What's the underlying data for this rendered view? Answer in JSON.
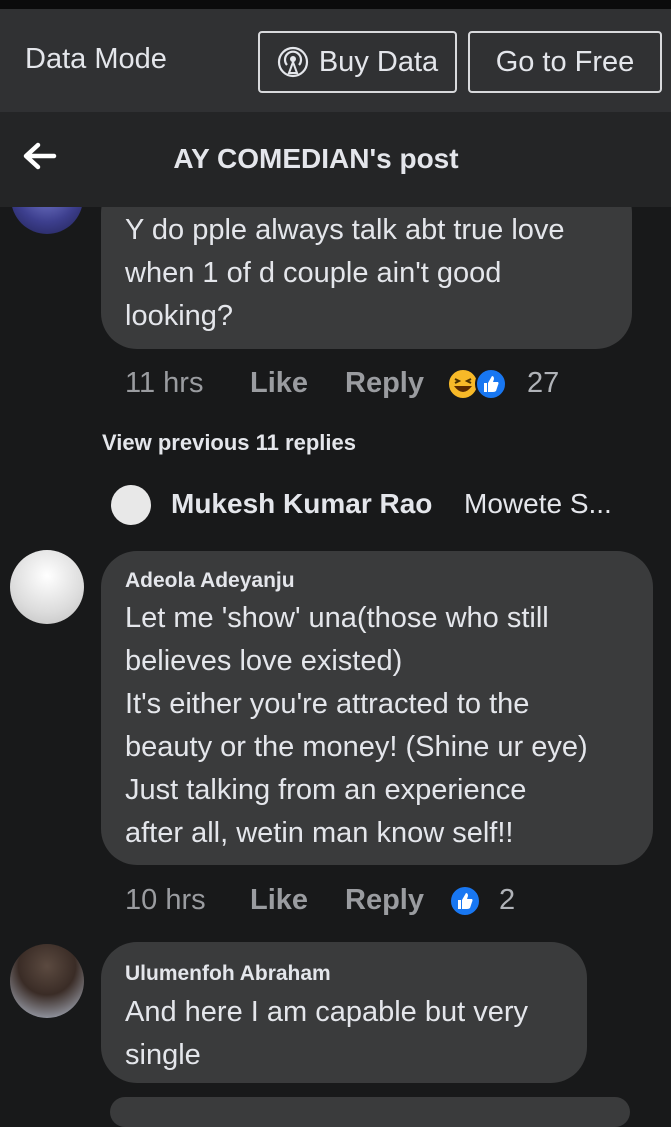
{
  "databar": {
    "label": "Data Mode",
    "buy_label": "Buy Data",
    "free_label": "Go to Free"
  },
  "header": {
    "title": "AY COMEDIAN's post",
    "back_icon": "back-arrow-icon"
  },
  "comments": [
    {
      "author": "",
      "lines": [
        "Y do pple always talk abt true love",
        "when 1 of d couple ain't good",
        "looking?"
      ],
      "time": "11 hrs",
      "like": "Like",
      "reply": "Reply",
      "reactions": [
        "haha-icon",
        "like-icon"
      ],
      "count": "27"
    },
    {
      "author": "Adeola Adeyanju",
      "lines": [
        "Let me 'show' una(those who still",
        "believes love existed)",
        "It's either you're attracted to the",
        "beauty or the money! (Shine ur eye)",
        "Just talking from an experience",
        "after all, wetin man know self!!"
      ],
      "time": "10 hrs",
      "like": "Like",
      "reply": "Reply",
      "reactions": [
        "like-icon"
      ],
      "count": "2"
    },
    {
      "author": "Ulumenfoh Abraham",
      "lines": [
        "And here I am capable but very",
        "single"
      ]
    }
  ],
  "view_previous": "View previous 11 replies",
  "reply_preview": {
    "name": "Mukesh Kumar Rao",
    "snippet": "Mowete S..."
  },
  "colors": {
    "background": "#18191a",
    "bubble": "#3a3b3c",
    "databar": "#303133",
    "like_blue": "#1877f2",
    "haha_yellow": "#f7b928"
  }
}
